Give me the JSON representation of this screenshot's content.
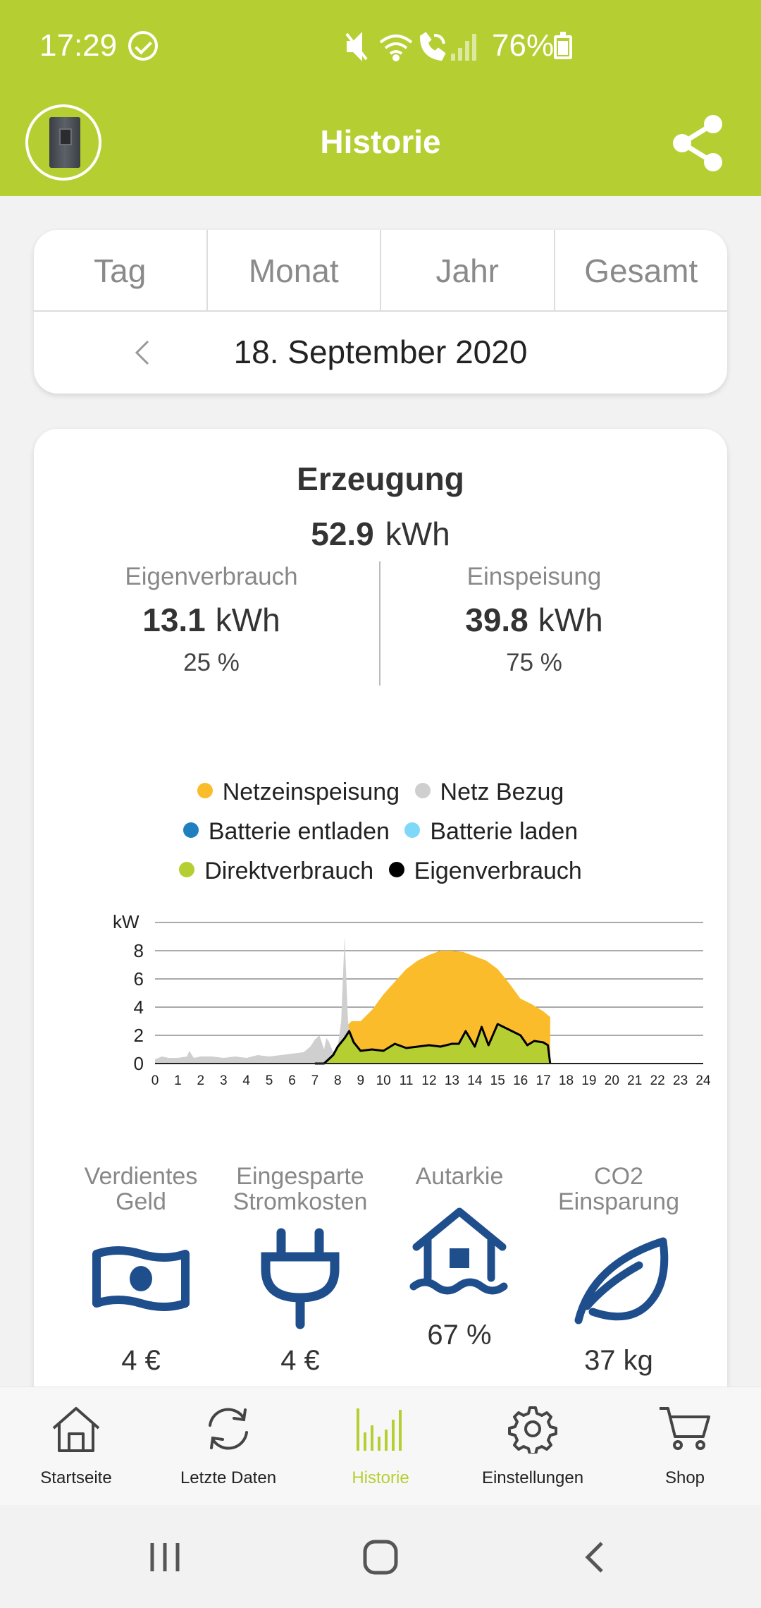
{
  "status_bar": {
    "time": "17:29",
    "battery": "76%",
    "battery_level": 0.76
  },
  "app_bar": {
    "title": "Historie"
  },
  "period": {
    "tabs": [
      {
        "label": "Tag",
        "active": true
      },
      {
        "label": "Monat",
        "active": false
      },
      {
        "label": "Jahr",
        "active": false
      },
      {
        "label": "Gesamt",
        "active": false
      }
    ],
    "date": "18. September 2020"
  },
  "summary": {
    "title": "Erzeugung",
    "total_value": "52.9",
    "total_unit": "kWh",
    "self_use": {
      "label": "Eigenverbrauch",
      "value": "13.1",
      "unit": "kWh",
      "percent": "25 %"
    },
    "feed_in": {
      "label": "Einspeisung",
      "value": "39.8",
      "unit": "kWh",
      "percent": "75 %"
    }
  },
  "chart_data": {
    "type": "area",
    "ylabel": "kW",
    "ylim": [
      0,
      10
    ],
    "yticks": [
      0,
      2,
      4,
      6,
      8
    ],
    "xlim": [
      0,
      24
    ],
    "xticks": [
      0,
      1,
      2,
      3,
      4,
      5,
      6,
      7,
      8,
      9,
      10,
      11,
      12,
      13,
      14,
      15,
      16,
      17,
      18,
      19,
      20,
      21,
      22,
      23,
      24
    ],
    "grid": true,
    "legend": [
      {
        "name": "Netzeinspeisung",
        "color": "#fbbc2c"
      },
      {
        "name": "Netz Bezug",
        "color": "#cfcfcf"
      },
      {
        "name": "Batterie entladen",
        "color": "#1f7fbf"
      },
      {
        "name": "Batterie laden",
        "color": "#7fd8f7"
      },
      {
        "name": "Direktverbrauch",
        "color": "#b5cf32"
      },
      {
        "name": "Eigenverbrauch",
        "color": "#000000"
      }
    ],
    "series": [
      {
        "name": "Netzeinspeisung",
        "color": "#fbbc2c",
        "x": [
          8.3,
          8.6,
          9.0,
          9.5,
          10.0,
          10.5,
          11.0,
          11.5,
          12.0,
          12.5,
          13.0,
          13.5,
          14.0,
          14.5,
          15.0,
          15.5,
          16.0,
          16.5,
          17.0,
          17.3
        ],
        "y": [
          2.5,
          3.0,
          3.0,
          3.8,
          4.9,
          5.8,
          6.7,
          7.3,
          7.7,
          8.0,
          8.0,
          7.9,
          7.6,
          7.3,
          6.7,
          5.7,
          4.6,
          4.2,
          3.7,
          3.3
        ]
      },
      {
        "name": "Netz Bezug",
        "color": "#cfcfcf",
        "x": [
          0,
          0.3,
          0.6,
          1.0,
          1.4,
          1.5,
          1.7,
          2.0,
          2.5,
          3.0,
          3.5,
          4.0,
          4.5,
          5.0,
          5.5,
          6.0,
          6.5,
          6.8,
          7.0,
          7.2,
          7.4,
          7.5,
          7.6,
          7.8,
          8.0,
          8.15,
          8.3,
          8.45,
          8.6
        ],
        "y": [
          0.3,
          0.5,
          0.4,
          0.4,
          0.5,
          0.9,
          0.4,
          0.5,
          0.5,
          0.4,
          0.5,
          0.4,
          0.6,
          0.5,
          0.6,
          0.7,
          0.8,
          1.2,
          1.7,
          2.0,
          1.0,
          1.8,
          1.6,
          0.8,
          1.2,
          3.0,
          9.0,
          3.0,
          1.0
        ]
      },
      {
        "name": "Direktverbrauch",
        "color": "#b5cf32",
        "x": [
          7.0,
          7.4,
          7.8,
          8.0,
          8.3,
          8.5,
          8.7,
          9.0,
          9.5,
          10.0,
          10.5,
          11.0,
          11.5,
          12.0,
          12.5,
          13.0,
          13.3,
          13.6,
          14.0,
          14.3,
          14.6,
          15.0,
          15.5,
          16.0,
          16.3,
          16.6,
          17.0,
          17.2,
          17.3
        ],
        "y": [
          0.0,
          0.0,
          0.6,
          1.2,
          1.8,
          2.3,
          1.5,
          0.9,
          1.0,
          0.9,
          1.4,
          1.1,
          1.2,
          1.3,
          1.2,
          1.4,
          1.4,
          2.3,
          1.2,
          2.6,
          1.3,
          2.8,
          2.4,
          2.0,
          1.3,
          1.6,
          1.5,
          1.3,
          0.0
        ]
      },
      {
        "name": "Eigenverbrauch",
        "color": "#000000",
        "x": [
          7.0,
          7.4,
          7.8,
          8.0,
          8.3,
          8.5,
          8.7,
          9.0,
          9.5,
          10.0,
          10.5,
          11.0,
          11.5,
          12.0,
          12.5,
          13.0,
          13.3,
          13.6,
          14.0,
          14.3,
          14.6,
          15.0,
          15.5,
          16.0,
          16.3,
          16.6,
          17.0,
          17.2,
          17.3
        ],
        "y": [
          0.0,
          0.0,
          0.6,
          1.2,
          1.8,
          2.3,
          1.5,
          0.9,
          1.0,
          0.9,
          1.4,
          1.1,
          1.2,
          1.3,
          1.2,
          1.4,
          1.4,
          2.3,
          1.2,
          2.6,
          1.3,
          2.8,
          2.4,
          2.0,
          1.3,
          1.6,
          1.5,
          1.3,
          0.0
        ]
      }
    ]
  },
  "stats": [
    {
      "label_line1": "Verdientes",
      "label_line2": "Geld",
      "icon": "banknote-icon",
      "value": "4 €"
    },
    {
      "label_line1": "Eingesparte",
      "label_line2": "Stromkosten",
      "icon": "plug-icon",
      "value": "4 €"
    },
    {
      "label_line1": "Autarkie",
      "label_line2": "",
      "icon": "house-flood-icon",
      "value": "67 %"
    },
    {
      "label_line1": "CO2",
      "label_line2": "Einsparung",
      "icon": "leaf-icon",
      "value": "37 kg"
    }
  ],
  "bottom_nav": [
    {
      "label": "Startseite",
      "icon": "home-icon",
      "active": false
    },
    {
      "label": "Letzte Daten",
      "icon": "refresh-icon",
      "active": false
    },
    {
      "label": "Historie",
      "icon": "history-bars-icon",
      "active": true
    },
    {
      "label": "Einstellungen",
      "icon": "gear-icon",
      "active": false
    },
    {
      "label": "Shop",
      "icon": "cart-icon",
      "active": false
    }
  ],
  "colors": {
    "brand": "#b5cf32",
    "icon_blue": "#1f4e8c"
  }
}
